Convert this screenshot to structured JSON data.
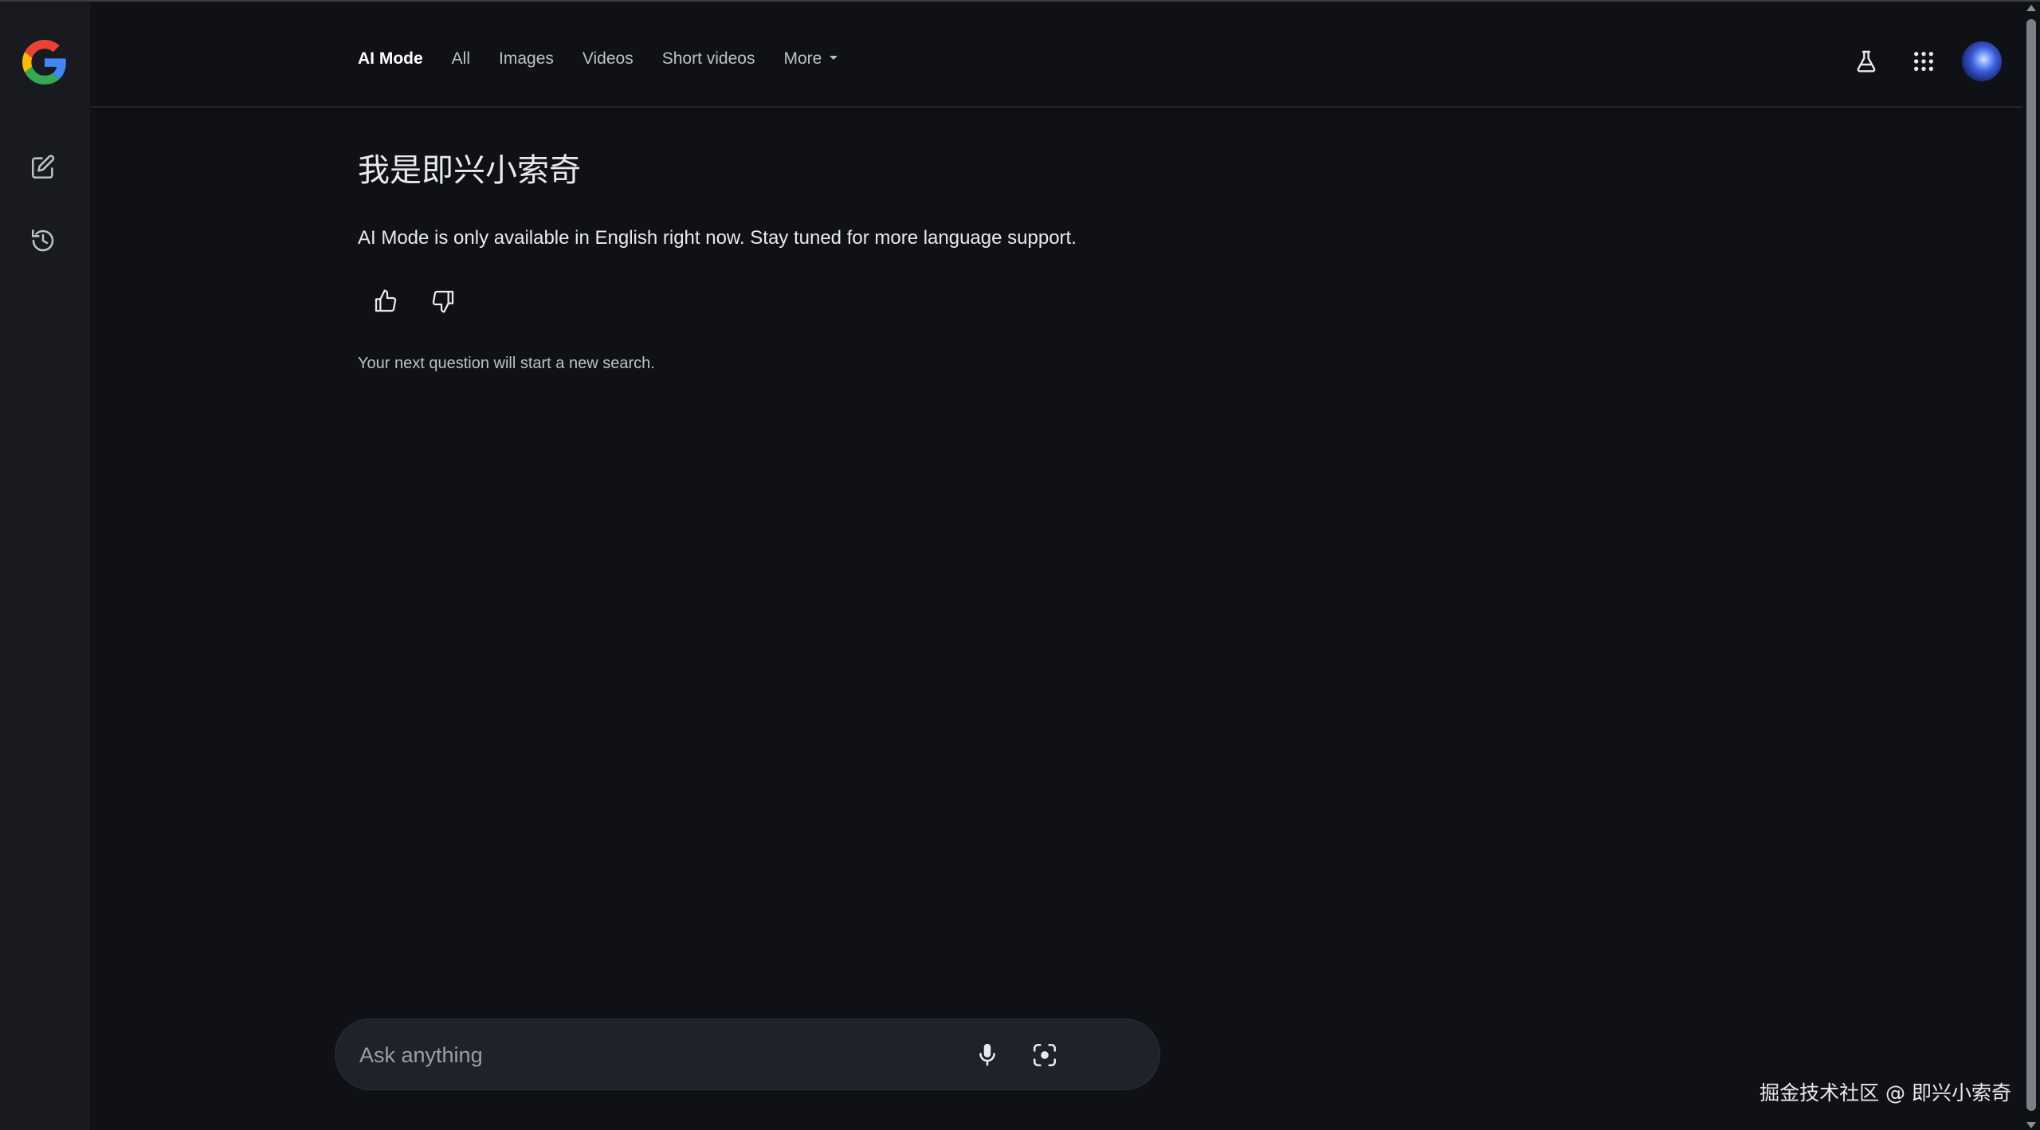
{
  "sidebar": {
    "logo_icon": "google-g-logo",
    "new_chat_icon": "edit-icon",
    "history_icon": "history-icon"
  },
  "tabs": [
    {
      "label": "AI Mode",
      "active": true
    },
    {
      "label": "All",
      "active": false
    },
    {
      "label": "Images",
      "active": false
    },
    {
      "label": "Videos",
      "active": false
    },
    {
      "label": "Short videos",
      "active": false
    },
    {
      "label": "More",
      "active": false
    }
  ],
  "header_right": {
    "labs_icon": "flask-icon",
    "apps_icon": "apps-grid-icon",
    "avatar": "account-avatar"
  },
  "main": {
    "query": "我是即兴小索奇",
    "response": "AI Mode is only available in English right now. Stay tuned for more language support.",
    "note": "Your next question will start a new search."
  },
  "askbox": {
    "placeholder": "Ask anything",
    "value": ""
  },
  "watermark": "掘金技术社区 @ 即兴小索奇",
  "colors": {
    "background": "#0f1116",
    "sidebar": "#181a20",
    "input_bg": "#1f2228",
    "text": "#e8eaed",
    "muted": "#bdc1c6"
  }
}
